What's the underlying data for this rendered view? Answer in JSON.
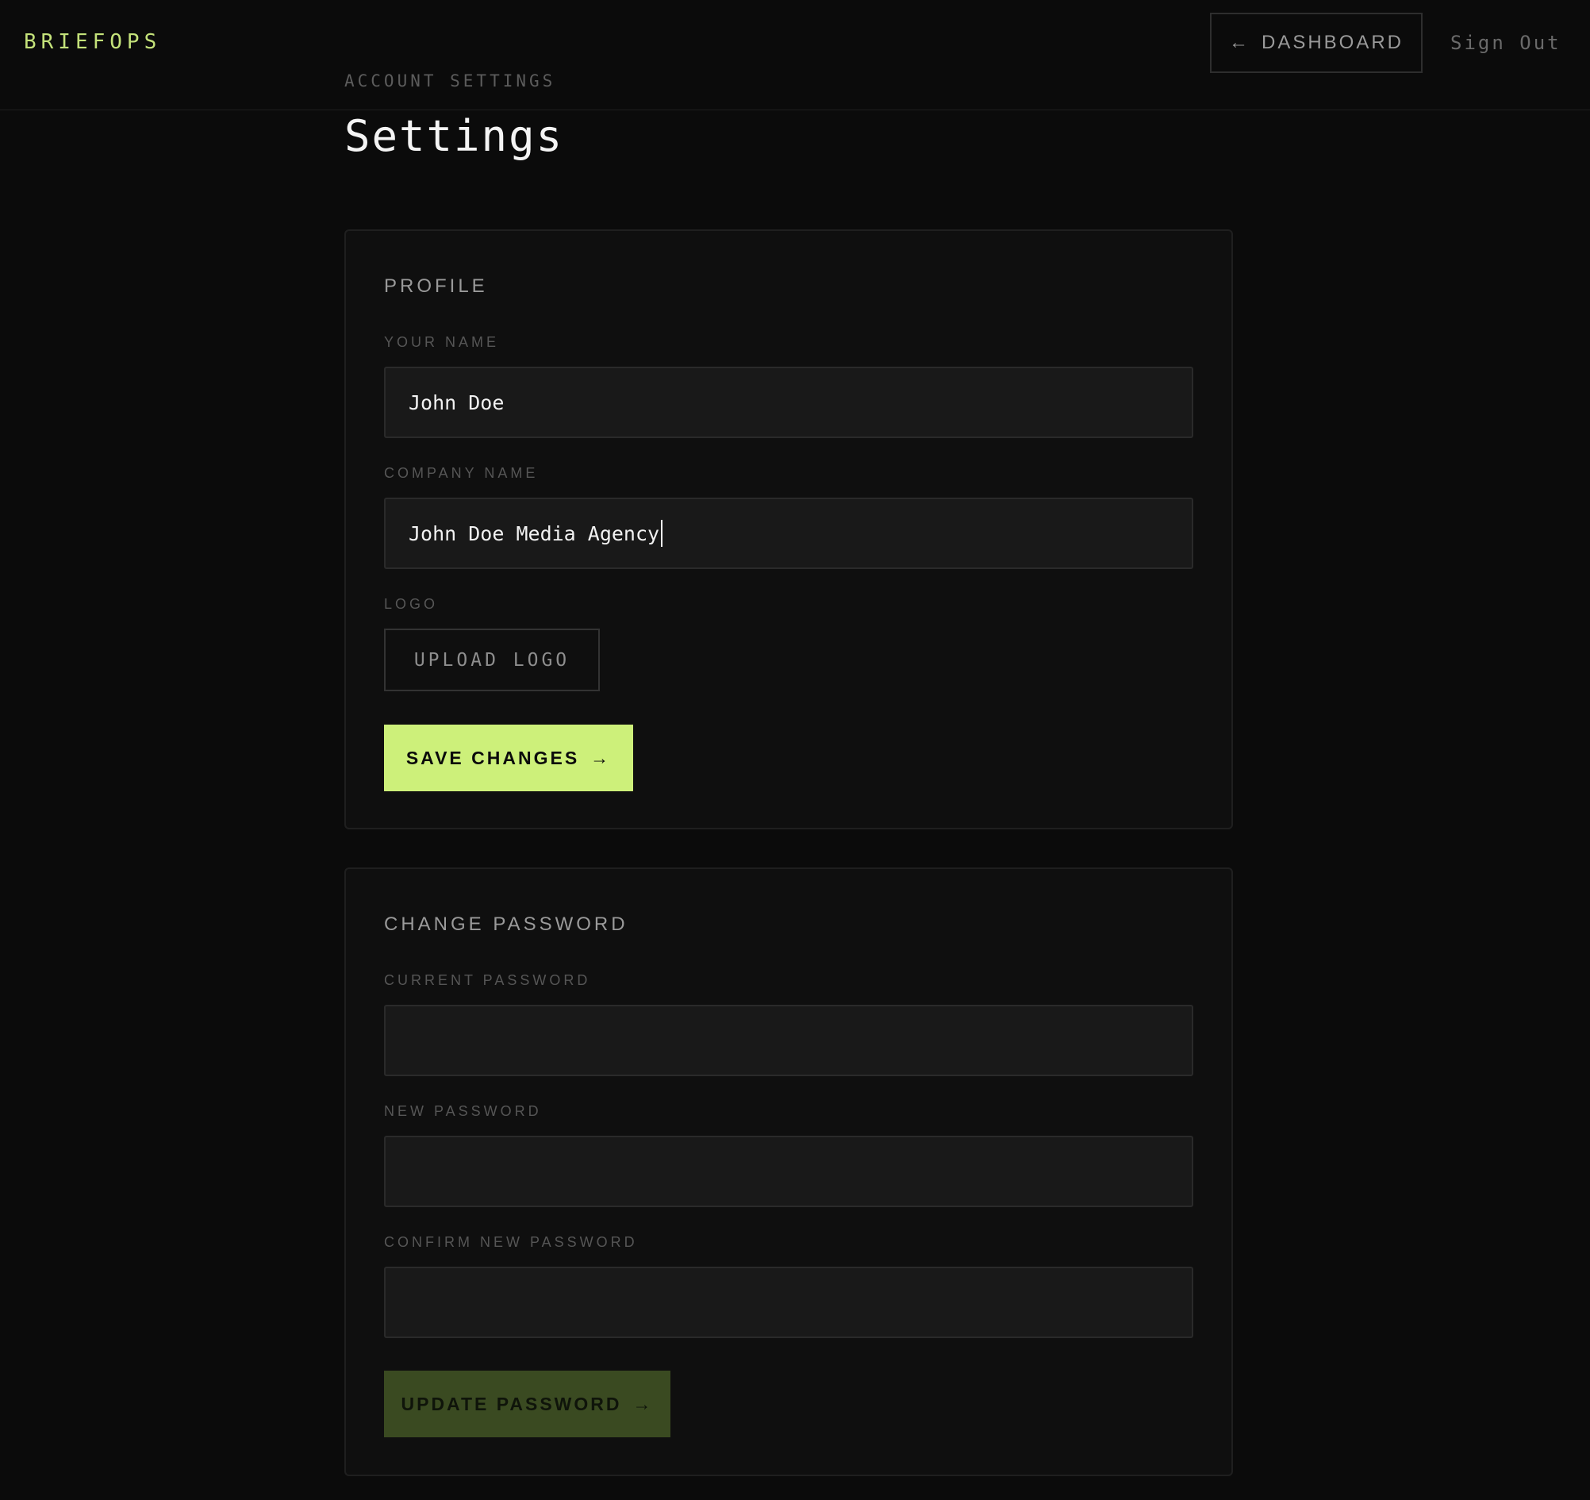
{
  "header": {
    "brand": "BRIEFOPS",
    "dashboard_label": "DASHBOARD",
    "dashboard_icon": "←",
    "signout_label": "Sign Out"
  },
  "page": {
    "eyebrow": "ACCOUNT SETTINGS",
    "title": "Settings"
  },
  "profile": {
    "section_title": "PROFILE",
    "name_label": "YOUR NAME",
    "name_value": "John Doe",
    "company_label": "COMPANY NAME",
    "company_value": "John Doe Media Agency",
    "logo_label": "LOGO",
    "upload_label": "UPLOAD LOGO",
    "save_label": "SAVE CHANGES",
    "save_icon": "→"
  },
  "password": {
    "section_title": "CHANGE PASSWORD",
    "current_label": "CURRENT PASSWORD",
    "current_value": "",
    "new_label": "NEW PASSWORD",
    "new_value": "",
    "confirm_label": "CONFIRM NEW PASSWORD",
    "confirm_value": "",
    "update_label": "UPDATE PASSWORD",
    "update_icon": "→"
  },
  "colors": {
    "accent": "#cdf07a",
    "accent_disabled": "#3a4a21",
    "background": "#0b0b0b",
    "card": "#0f0f0f",
    "input": "#191919"
  }
}
